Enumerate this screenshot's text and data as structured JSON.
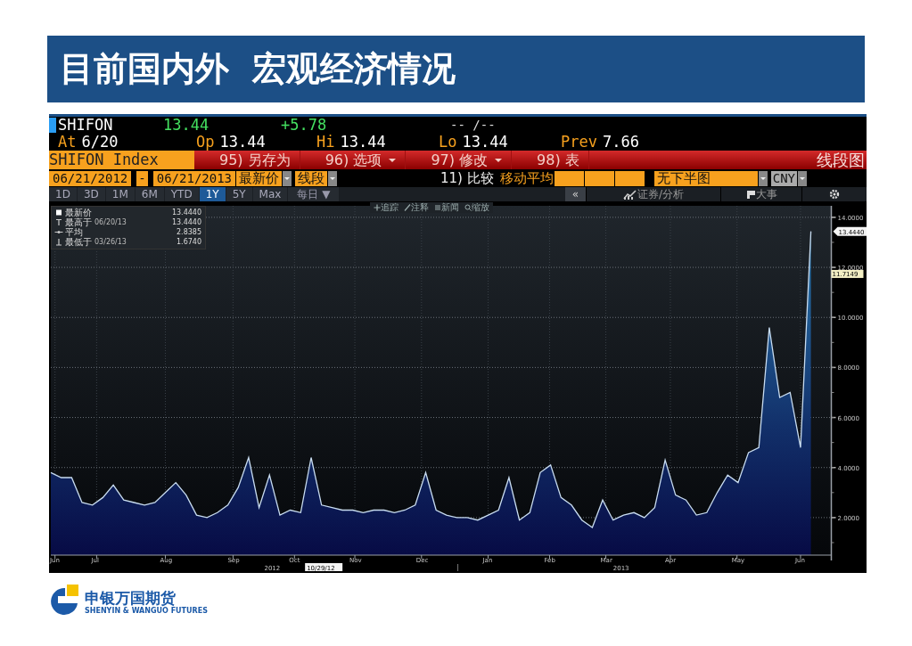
{
  "slide_title": "目前国内外  宏观经济情况",
  "quote": {
    "ticker": "SHIFON",
    "last": "13.44",
    "change": "+5.78",
    "time": "-- /--",
    "fields": [
      {
        "label": "At",
        "value": "6/20"
      },
      {
        "label": "Op",
        "value": "13.44"
      },
      {
        "label": "Hi",
        "value": "13.44"
      },
      {
        "label": "Lo",
        "value": "13.44"
      },
      {
        "label": "Prev",
        "value": "7.66"
      }
    ]
  },
  "command_bar": {
    "security": "SHIFON Index",
    "buttons": [
      {
        "label": "95) 另存为",
        "dropdown": false
      },
      {
        "label": "96) 选项",
        "dropdown": true
      },
      {
        "label": "97) 修改",
        "dropdown": true
      },
      {
        "label": "98) 表",
        "dropdown": false
      }
    ],
    "view": "线段图"
  },
  "settings_bar": {
    "start_date": "06/21/2012",
    "separator": "-",
    "end_date": "06/21/2013",
    "price_field": "最新价",
    "chart_type": "线段",
    "compare": "11) 比较",
    "moving_average": "移动平均",
    "lower_chart": "无下半图",
    "currency": "CNY"
  },
  "periods": [
    {
      "label": "1D",
      "selected": false
    },
    {
      "label": "3D",
      "selected": false
    },
    {
      "label": "1M",
      "selected": false
    },
    {
      "label": "6M",
      "selected": false
    },
    {
      "label": "YTD",
      "selected": false
    },
    {
      "label": "1Y",
      "selected": true
    },
    {
      "label": "5Y",
      "selected": false
    },
    {
      "label": "Max",
      "selected": false
    }
  ],
  "frequency": "每日 ▼",
  "right_tools": {
    "collapse": "«",
    "analysis": "证券/分析",
    "events": "大事"
  },
  "chart_tools": [
    "追踪",
    "注释",
    "新闻",
    "缩放"
  ],
  "legend": [
    {
      "kind": "last",
      "label": "最新价",
      "value": "13.4440"
    },
    {
      "kind": "high",
      "label": "最高于",
      "date": "06/20/13",
      "value": "13.4440"
    },
    {
      "kind": "average",
      "label": "平均",
      "value": "2.8385"
    },
    {
      "kind": "low",
      "label": "最低于",
      "date": "03/26/13",
      "value": "1.6740"
    }
  ],
  "last_price_tag": "13.4440",
  "moving_average_tag": "11.7149",
  "crosshair_date": "10/29/12",
  "years": [
    "2012",
    "2013"
  ],
  "months": [
    "Jun",
    "Jul",
    "Aug",
    "Sep",
    "Oct",
    "Nov",
    "Dec",
    "Jan",
    "Feb",
    "Mar",
    "Apr",
    "May",
    "Jun"
  ],
  "chart_data": {
    "type": "area",
    "grid": true,
    "ylim": [
      0.5,
      14.46
    ],
    "series": [
      {
        "color": "#c8dcf0",
        "values": [
          3.8,
          3.6,
          3.6,
          2.6,
          2.5,
          2.8,
          3.3,
          2.7,
          2.6,
          2.5,
          2.6,
          3.0,
          3.4,
          2.9,
          2.1,
          2.0,
          2.2,
          2.5,
          3.2,
          4.4,
          2.4,
          3.7,
          2.1,
          2.3,
          2.2,
          4.4,
          2.5,
          2.4,
          2.3,
          2.3,
          2.2,
          2.3,
          2.3,
          2.2,
          2.3,
          2.5,
          3.8,
          2.3,
          2.1,
          2.0,
          2.0,
          1.9,
          2.1,
          2.3,
          3.6,
          1.9,
          2.2,
          3.8,
          4.1,
          2.8,
          2.5,
          1.9,
          1.6,
          2.7,
          1.9,
          2.1,
          2.2,
          2.0,
          2.4,
          4.3,
          2.9,
          2.7,
          2.1,
          2.2,
          3.0,
          3.7,
          3.4,
          4.6,
          4.8,
          9.6,
          6.8,
          7.0,
          4.8,
          13.44
        ]
      }
    ],
    "yticks": [
      {
        "value": 2,
        "label": "2.0000"
      },
      {
        "value": 4,
        "label": "4.0000"
      },
      {
        "value": 6,
        "label": "6.0000"
      },
      {
        "value": 8,
        "label": "8.0000"
      },
      {
        "value": 10,
        "label": "10.0000"
      },
      {
        "value": 12,
        "label": "12.0000"
      },
      {
        "value": 14,
        "label": "14.0000"
      }
    ]
  },
  "footer": {
    "brand": "申银万国期货",
    "brand_en": "SHENYIN & WANGUO FUTURES"
  }
}
